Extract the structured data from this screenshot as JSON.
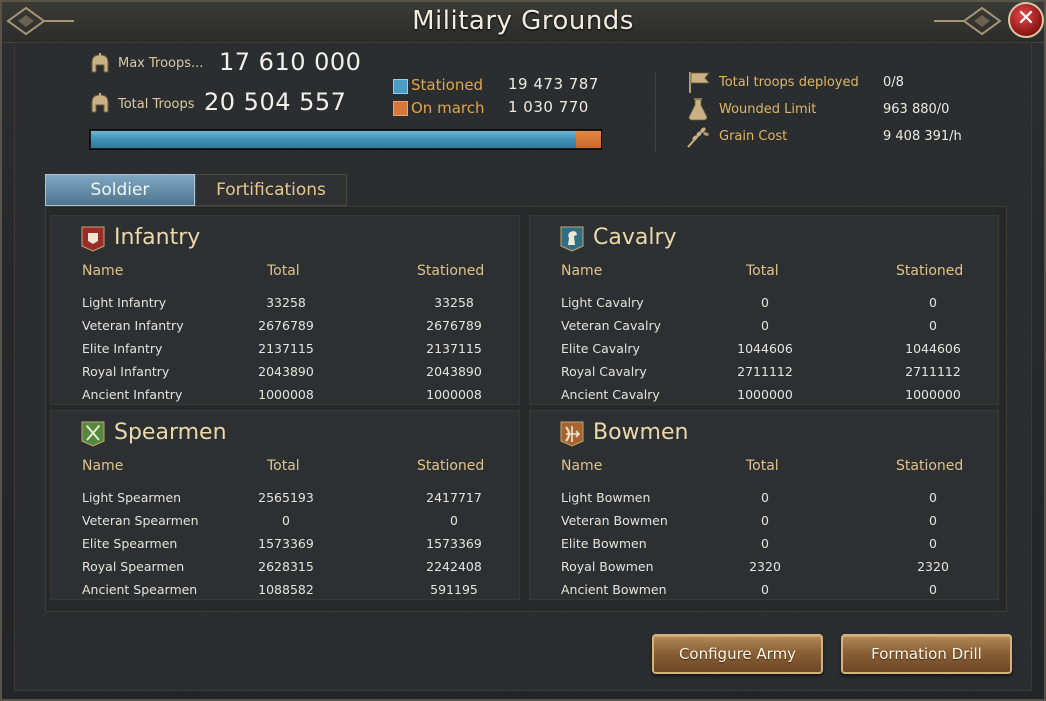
{
  "window": {
    "title": "Military Grounds",
    "close_glyph": "✕"
  },
  "header": {
    "max_troops_label": "Max Troops...",
    "max_troops_value": "17 610 000",
    "total_troops_label": "Total Troops",
    "total_troops_value": "20 504 557",
    "legend": {
      "stationed_label": "Stationed",
      "stationed_value": "19 473 787",
      "on_march_label": "On march",
      "on_march_value": "1 030 770"
    },
    "progress": {
      "stationed_fraction": 0.95,
      "on_march_fraction": 0.05
    },
    "right_stats": [
      {
        "icon": "flag-icon",
        "label": "Total troops deployed",
        "value": "0/8"
      },
      {
        "icon": "potion-icon",
        "label": "Wounded Limit",
        "value": "963 880/0"
      },
      {
        "icon": "grain-icon",
        "label": "Grain Cost",
        "value": "9 408 391/h"
      }
    ]
  },
  "tabs": [
    {
      "label": "Soldier",
      "active": true
    },
    {
      "label": "Fortifications",
      "active": false
    }
  ],
  "columns": {
    "name": "Name",
    "total": "Total",
    "stationed": "Stationed"
  },
  "panels": {
    "infantry": {
      "title": "Infantry",
      "icon": "shield-icon",
      "rows": [
        {
          "name": "Light Infantry",
          "total": "33258",
          "stationed": "33258"
        },
        {
          "name": "Veteran Infantry",
          "total": "2676789",
          "stationed": "2676789"
        },
        {
          "name": "Elite Infantry",
          "total": "2137115",
          "stationed": "2137115"
        },
        {
          "name": "Royal Infantry",
          "total": "2043890",
          "stationed": "2043890"
        },
        {
          "name": "Ancient Infantry",
          "total": "1000008",
          "stationed": "1000008"
        }
      ]
    },
    "cavalry": {
      "title": "Cavalry",
      "icon": "horse-icon",
      "rows": [
        {
          "name": "Light Cavalry",
          "total": "0",
          "stationed": "0"
        },
        {
          "name": "Veteran Cavalry",
          "total": "0",
          "stationed": "0"
        },
        {
          "name": "Elite Cavalry",
          "total": "1044606",
          "stationed": "1044606"
        },
        {
          "name": "Royal Cavalry",
          "total": "2711112",
          "stationed": "2711112"
        },
        {
          "name": "Ancient Cavalry",
          "total": "1000000",
          "stationed": "1000000"
        }
      ]
    },
    "spearmen": {
      "title": "Spearmen",
      "icon": "crossed-spears-icon",
      "rows": [
        {
          "name": "Light Spearmen",
          "total": "2565193",
          "stationed": "2417717"
        },
        {
          "name": "Veteran Spearmen",
          "total": "0",
          "stationed": "0"
        },
        {
          "name": "Elite Spearmen",
          "total": "1573369",
          "stationed": "1573369"
        },
        {
          "name": "Royal Spearmen",
          "total": "2628315",
          "stationed": "2242408"
        },
        {
          "name": "Ancient Spearmen",
          "total": "1088582",
          "stationed": "591195"
        }
      ]
    },
    "bowmen": {
      "title": "Bowmen",
      "icon": "bow-icon",
      "rows": [
        {
          "name": "Light Bowmen",
          "total": "0",
          "stationed": "0"
        },
        {
          "name": "Veteran Bowmen",
          "total": "0",
          "stationed": "0"
        },
        {
          "name": "Elite Bowmen",
          "total": "0",
          "stationed": "0"
        },
        {
          "name": "Royal Bowmen",
          "total": "2320",
          "stationed": "2320"
        },
        {
          "name": "Ancient Bowmen",
          "total": "0",
          "stationed": "0"
        }
      ]
    }
  },
  "buttons": {
    "configure_army": "Configure Army",
    "formation_drill": "Formation Drill"
  },
  "colors": {
    "stationed": "#4a9cc4",
    "on_march": "#d9773a",
    "accent_gold": "#e0b663",
    "infantry_badge": "#9a2b2b",
    "cavalry_badge": "#2f6f86",
    "spearmen_badge": "#4f8a3f",
    "bowmen_badge": "#a8642f"
  }
}
